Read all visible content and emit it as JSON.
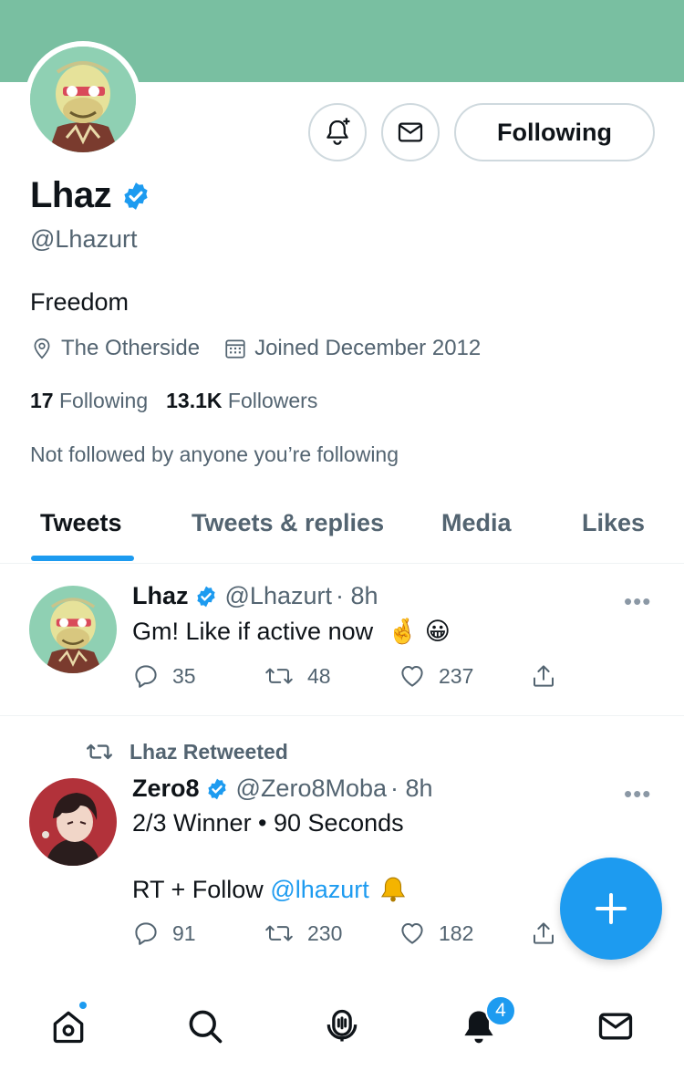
{
  "profile": {
    "name": "Lhaz",
    "handle": "@Lhazurt",
    "bio": "Freedom",
    "location": "The Otherside",
    "joined": "Joined December 2012",
    "following_count": "17",
    "following_label": "Following",
    "followers_count": "13.1K",
    "followers_label": "Followers",
    "not_followed_text": "Not followed by anyone you’re following",
    "follow_button_label": "Following"
  },
  "tabs": [
    {
      "label": "Tweets"
    },
    {
      "label": "Tweets & replies"
    },
    {
      "label": "Media"
    },
    {
      "label": "Likes"
    }
  ],
  "tweets": [
    {
      "name": "Lhaz",
      "handle": "@Lhazurt",
      "time": "· 8h",
      "text": "Gm! Like if active now",
      "emoji": "🤞 😀",
      "replies": "35",
      "retweets": "48",
      "likes": "237"
    },
    {
      "retweet_label": "Lhaz Retweeted",
      "name": "Zero8",
      "handle": "@Zero8Moba",
      "time": "· 8h",
      "line1": "2/3 Winner • 90 Seconds",
      "line2_prefix": "RT + Follow ",
      "line2_link": "@lhazurt",
      "replies": "91",
      "retweets": "230",
      "likes": "182"
    }
  ],
  "nav": {
    "notification_badge": "4"
  },
  "colors": {
    "banner": "#79bfa1",
    "accent": "#1d9bf0",
    "verified": "#1d9bf0"
  }
}
